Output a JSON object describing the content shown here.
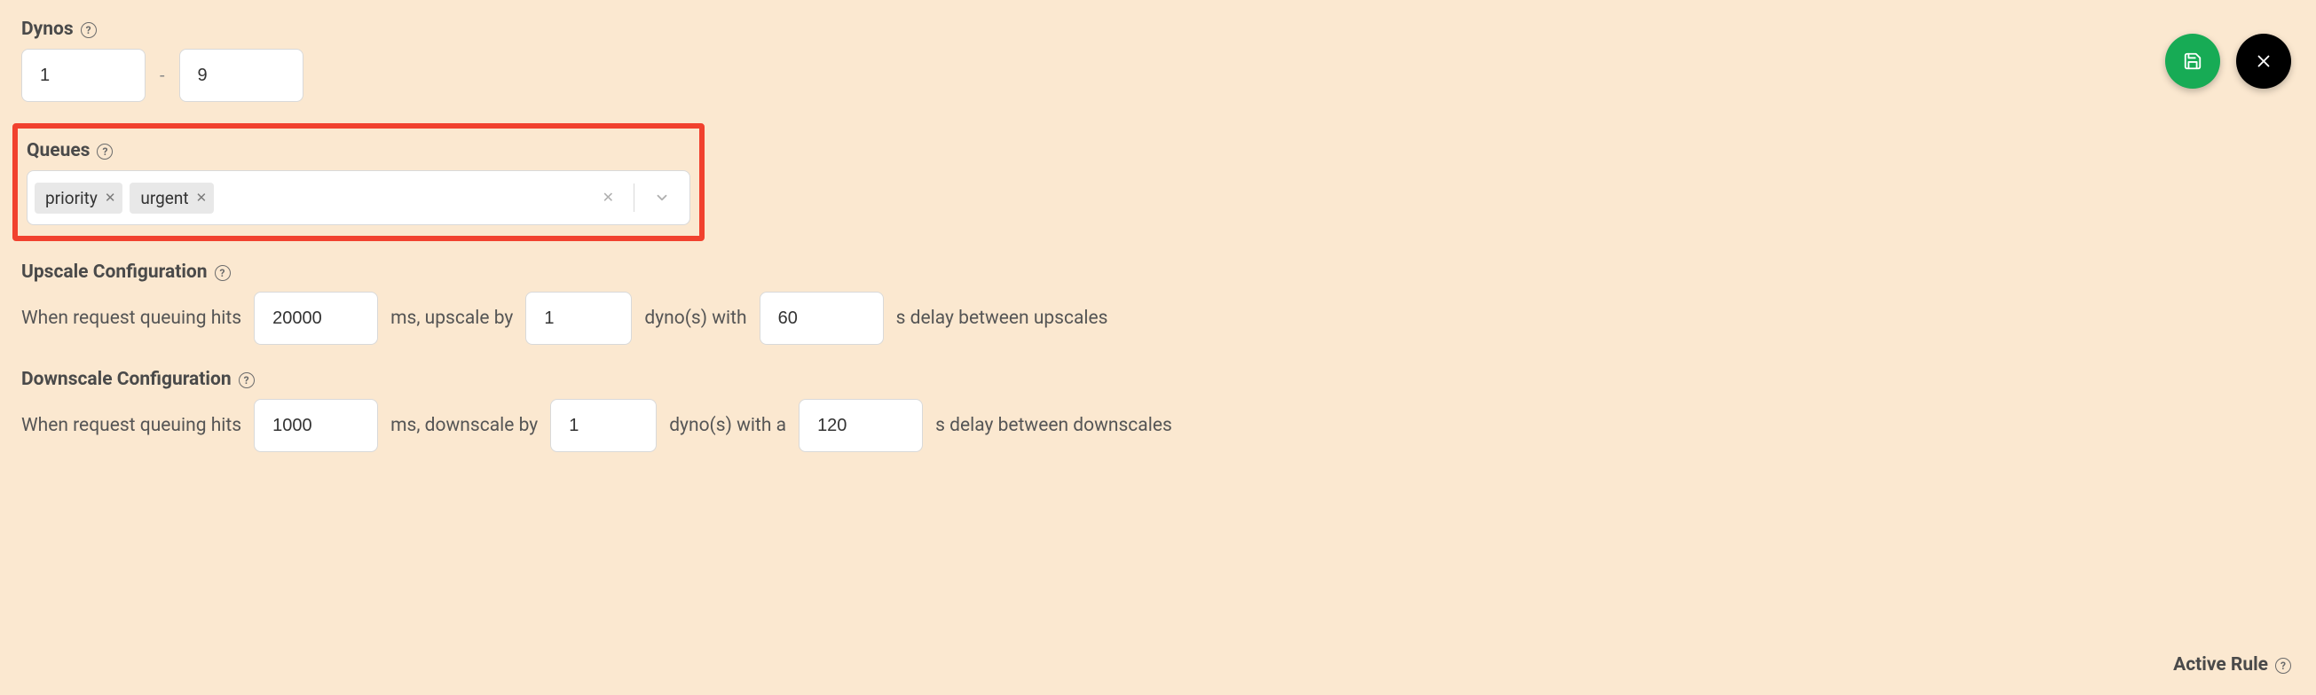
{
  "dynos": {
    "label": "Dynos",
    "min": "1",
    "max": "9"
  },
  "queues": {
    "label": "Queues",
    "tags": [
      "priority",
      "urgent"
    ]
  },
  "upscale": {
    "label": "Upscale Configuration",
    "prefix": "When request queuing hits",
    "threshold_ms": "20000",
    "unit1": "ms, upscale by",
    "dynos": "1",
    "unit2": "dyno(s) with",
    "delay_s": "60",
    "unit3": "s delay between upscales"
  },
  "downscale": {
    "label": "Downscale Configuration",
    "prefix": "When request queuing hits",
    "threshold_ms": "1000",
    "unit1": "ms, downscale by",
    "dynos": "1",
    "unit2": "dyno(s) with a",
    "delay_s": "120",
    "unit3": "s delay between downscales"
  },
  "active_rule": {
    "label": "Active Rule"
  }
}
